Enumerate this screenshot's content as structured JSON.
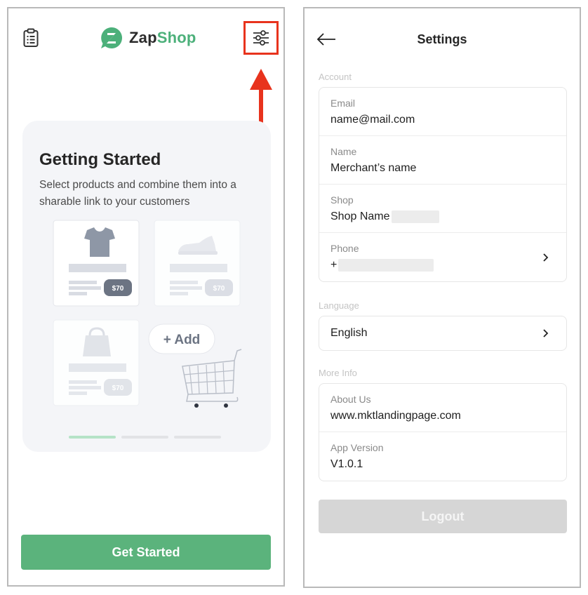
{
  "colors": {
    "brand_green": "#4cb07a",
    "button_green": "#5bb37c",
    "highlight_red": "#e8331d",
    "logout_disabled": "#d6d6d6"
  },
  "left_screen": {
    "header": {
      "clipboard_icon": "clipboard-icon",
      "brand_zap": "Zap",
      "brand_shop": "Shop",
      "settings_icon": "sliders-icon"
    },
    "onboarding": {
      "title": "Getting Started",
      "description": "Select products and combine them into a sharable link to your customers",
      "price_tags": [
        "$70",
        "$70",
        "$70"
      ],
      "add_label": "+ Add",
      "page_count": 3,
      "active_page": 1
    },
    "cta_label": "Get Started"
  },
  "right_screen": {
    "title": "Settings",
    "account": {
      "section_label": "Account",
      "email_label": "Email",
      "email_value": "name@mail.com",
      "name_label": "Name",
      "name_value": "Merchant’s name",
      "shop_label": "Shop",
      "shop_value": "Shop Name",
      "phone_label": "Phone",
      "phone_value": "+"
    },
    "language": {
      "section_label": "Language",
      "value": "English"
    },
    "more_info": {
      "section_label": "More Info",
      "about_label": "About Us",
      "about_value": "www.mktlandingpage.com",
      "version_label": "App Version",
      "version_value": "V1.0.1"
    },
    "logout_label": "Logout"
  }
}
